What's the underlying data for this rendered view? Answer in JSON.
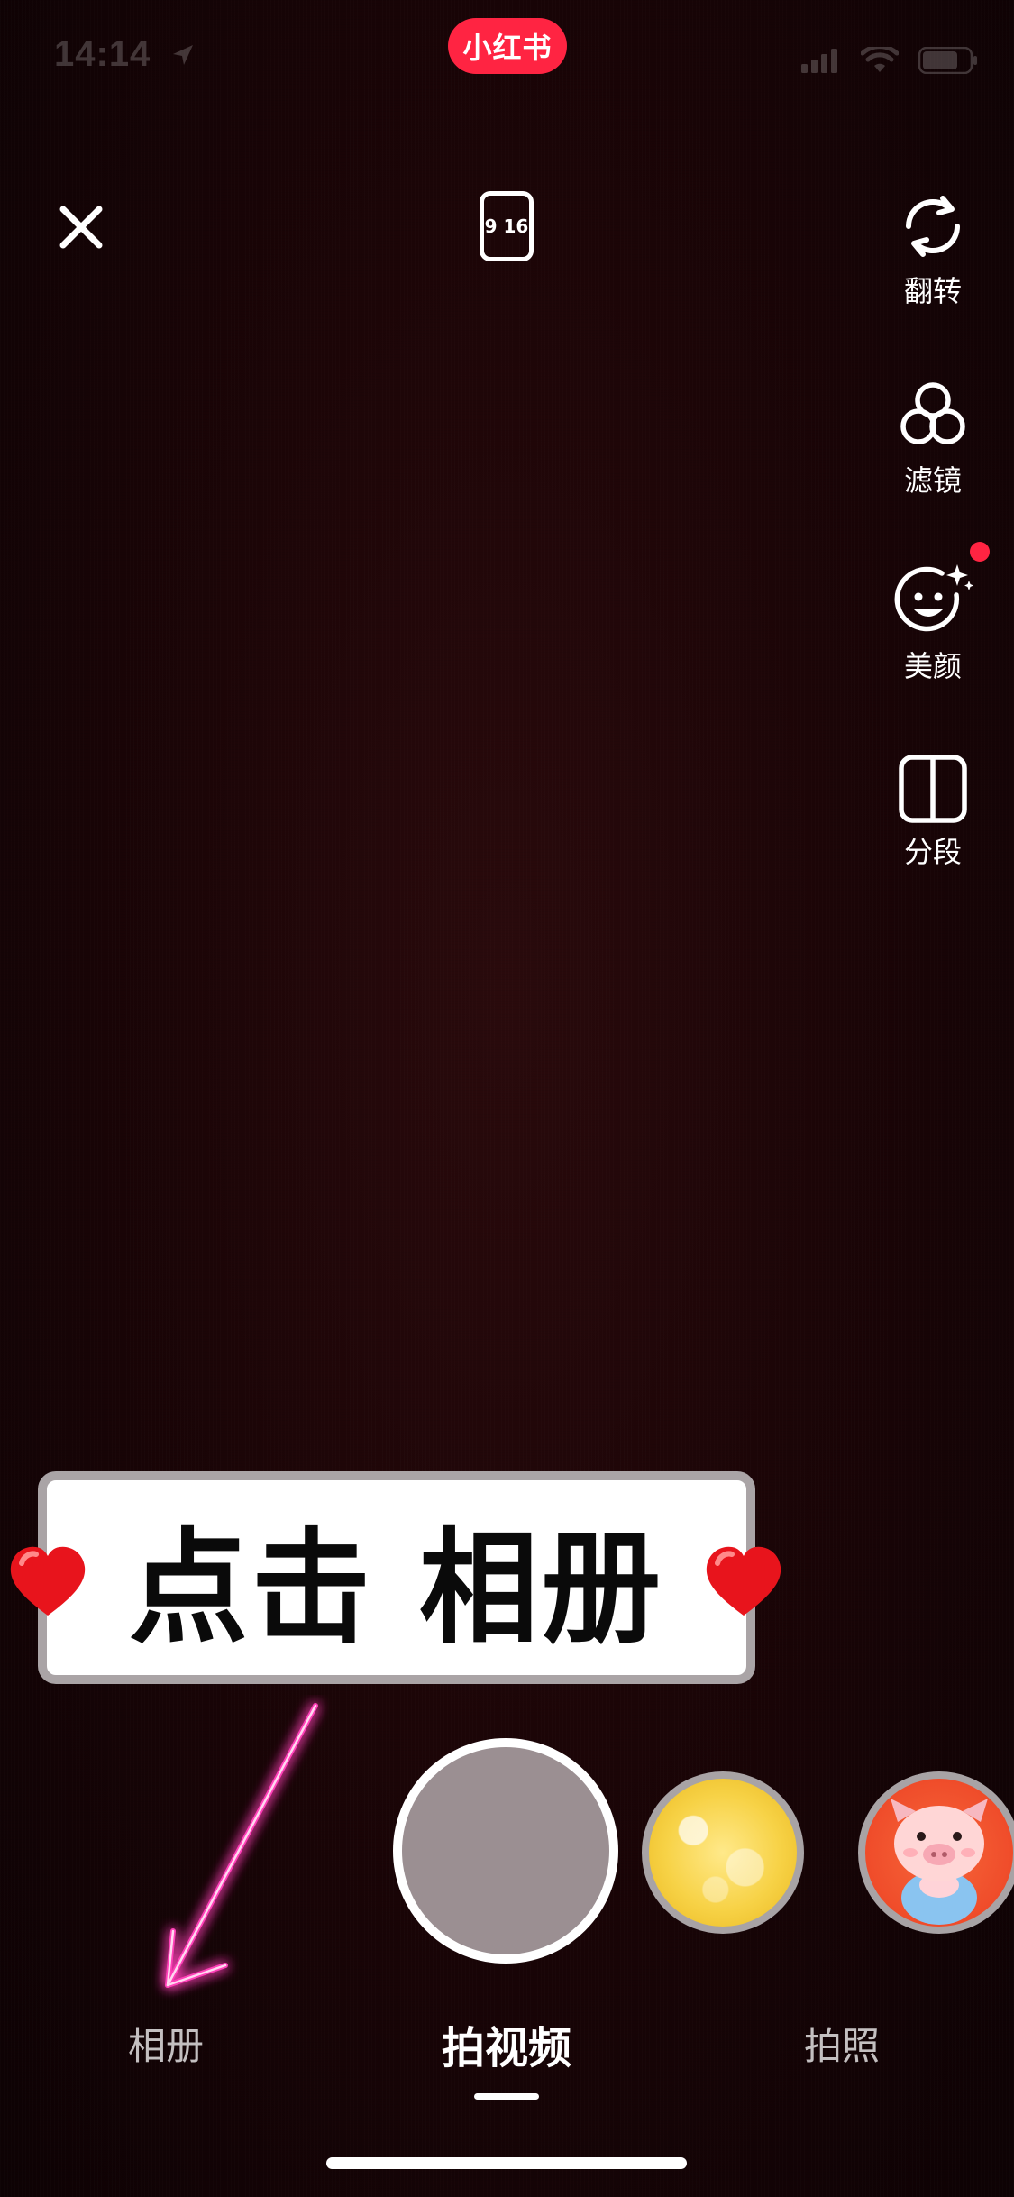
{
  "status_bar": {
    "time": "14:14",
    "icons": [
      "location-arrow-icon",
      "signal-icon",
      "wifi-icon",
      "battery-icon"
    ]
  },
  "app_badge": {
    "label": "小红书",
    "color": "#ff2442"
  },
  "top_bar": {
    "close_icon": "close-icon",
    "aspect_ratio": "9 16"
  },
  "right_tools": [
    {
      "label": "翻转",
      "icon": "flip-camera-icon"
    },
    {
      "label": "滤镜",
      "icon": "filter-icon"
    },
    {
      "label": "美颜",
      "icon": "beauty-face-icon",
      "has_notification_dot": true
    },
    {
      "label": "分段",
      "icon": "segment-icon"
    }
  ],
  "banner": {
    "text": "点击 相册",
    "decorations": [
      "heart-icon",
      "heart-icon"
    ]
  },
  "effects": [
    {
      "name": "gold-bubbles-effect",
      "selected": false
    },
    {
      "name": "pig-sticker-effect",
      "selected": false
    }
  ],
  "modes": {
    "album": "相册",
    "video": "拍视频",
    "photo": "拍照",
    "active": "拍视频"
  },
  "colors": {
    "accent": "#ff2442",
    "shutter_fill": "#9b8f92",
    "arrow_glow": "#ff3fb8"
  }
}
